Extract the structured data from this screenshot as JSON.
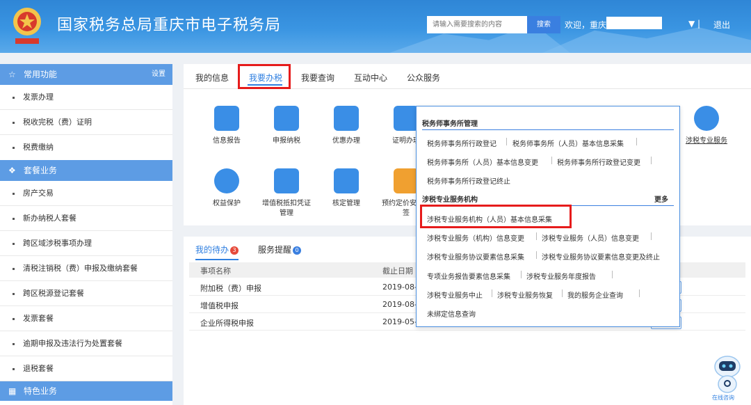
{
  "header": {
    "title": "国家税务总局重庆市电子税务局",
    "search_placeholder": "请输入需要搜索的内容",
    "search_button": "搜索",
    "welcome": "欢迎，重庆",
    "user_caret": "▼ |",
    "logout": "退出"
  },
  "sidebar": {
    "common_header": "常用功能",
    "common_setting": "设置",
    "common_items": [
      "发票办理",
      "税收完税（费）证明",
      "税费缴纳"
    ],
    "package_header": "套餐业务",
    "package_items": [
      "房产交易",
      "新办纳税人套餐",
      "跨区域涉税事项办理",
      "清税注销税（费）申报及缴纳套餐",
      "跨区税源登记套餐",
      "发票套餐",
      "逾期申报及违法行为处置套餐",
      "退税套餐"
    ],
    "special_header": "特色业务"
  },
  "top_tabs": [
    "我的信息",
    "我要办税",
    "我要查询",
    "互动中心",
    "公众服务"
  ],
  "tiles": [
    {
      "label": "信息报告",
      "color": "#3a8ee6"
    },
    {
      "label": "申报纳税",
      "color": "#3a8ee6"
    },
    {
      "label": "优惠办理",
      "color": "#3a8ee6"
    },
    {
      "label": "证明办理",
      "color": "#3a8ee6"
    },
    {
      "label": "涉税专业服务",
      "color": "#3a8ee6"
    },
    {
      "label": "权益保护",
      "color": "#3a8ee6"
    },
    {
      "label": "增值税抵扣凭证管理",
      "color": "#3a8ee6"
    },
    {
      "label": "核定管理",
      "color": "#3a8ee6"
    },
    {
      "label": "预约定价安排谈签",
      "color": "#f0a030"
    }
  ],
  "todo": {
    "tab_mine": "我的待办",
    "tab_mine_count": "3",
    "tab_remind": "服务提醒",
    "tab_remind_count": "0",
    "col_name": "事项名称",
    "col_deadline": "截止日期",
    "rows": [
      {
        "name": "附加税（费）申报",
        "date": "2019-08-"
      },
      {
        "name": "增值税申报",
        "date": "2019-08-"
      },
      {
        "name": "企业所得税申报",
        "date": "2019-05-"
      }
    ]
  },
  "dropdown": {
    "section1": "税务师事务所管理",
    "s1_links": [
      "税务师事务所行政登记",
      "税务师事务所（人员）基本信息采集",
      "税务师事务所（人员）基本信息变更",
      "税务师事务所行政登记变更",
      "税务师事务所行政登记终止"
    ],
    "section2": "涉税专业服务机构",
    "more": "更多",
    "s2_links": [
      "涉税专业服务机构（人员）基本信息采集",
      "涉税专业服务（机构）信息变更",
      "涉税专业服务（人员）信息变更",
      "涉税专业服务协议要素信息采集",
      "涉税专业服务协议要素信息变更及终止",
      "专项业务报告要素信息采集",
      "涉税专业服务年度报告",
      "涉税专业服务中止",
      "涉税专业服务恢复",
      "我的服务企业查询",
      "未绑定信息查询"
    ]
  },
  "robot": {
    "label": "在线咨询"
  }
}
